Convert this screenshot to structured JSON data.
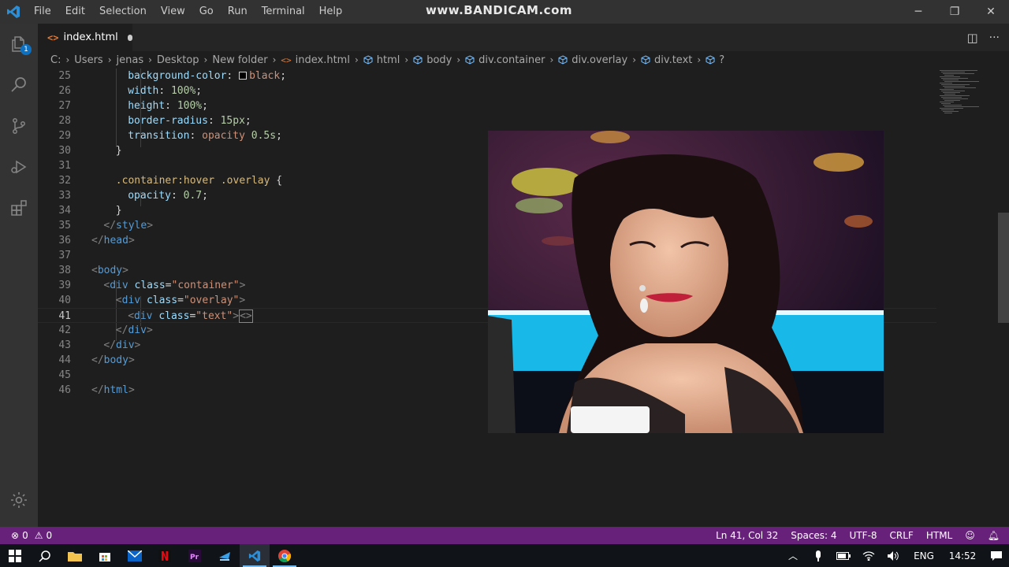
{
  "titlebar": {
    "menu": [
      "File",
      "Edit",
      "Selection",
      "View",
      "Go",
      "Run",
      "Terminal",
      "Help"
    ],
    "watermark": "www.BANDICAM.com",
    "controls": {
      "minimize": "─",
      "restore": "❐",
      "close": "✕"
    }
  },
  "activitybar": {
    "items": [
      "explorer-icon",
      "search-icon",
      "source-control-icon",
      "run-debug-icon",
      "extensions-icon"
    ],
    "explorer_badge": "1",
    "bottom": "gear-icon"
  },
  "tab": {
    "icon": "<>",
    "label": "index.html",
    "actions": {
      "split": "◫",
      "more": "···"
    }
  },
  "breadcrumb": {
    "path": [
      "C:",
      "Users",
      "jenas",
      "Desktop",
      "New folder"
    ],
    "file": "index.html",
    "symbols": [
      "html",
      "body",
      "div.container",
      "div.overlay",
      "div.text",
      "?"
    ]
  },
  "editor": {
    "current_line": 41,
    "lines": [
      {
        "n": "25",
        "indent": 6,
        "tokens": [
          [
            "prop",
            "background-color"
          ],
          [
            "punc",
            ": "
          ],
          [
            "swatch",
            ""
          ],
          [
            "val",
            "black"
          ],
          [
            "punc",
            ";"
          ]
        ]
      },
      {
        "n": "26",
        "indent": 6,
        "tokens": [
          [
            "prop",
            "width"
          ],
          [
            "punc",
            ": "
          ],
          [
            "num",
            "100%"
          ],
          [
            "punc",
            ";"
          ]
        ]
      },
      {
        "n": "27",
        "indent": 6,
        "tokens": [
          [
            "prop",
            "height"
          ],
          [
            "punc",
            ": "
          ],
          [
            "num",
            "100%"
          ],
          [
            "punc",
            ";"
          ]
        ]
      },
      {
        "n": "28",
        "indent": 6,
        "tokens": [
          [
            "prop",
            "border-radius"
          ],
          [
            "punc",
            ": "
          ],
          [
            "num",
            "15px"
          ],
          [
            "punc",
            ";"
          ]
        ]
      },
      {
        "n": "29",
        "indent": 6,
        "tokens": [
          [
            "prop",
            "transition"
          ],
          [
            "punc",
            ": "
          ],
          [
            "val",
            "opacity "
          ],
          [
            "num",
            "0.5s"
          ],
          [
            "punc",
            ";"
          ]
        ]
      },
      {
        "n": "30",
        "indent": 4,
        "tokens": [
          [
            "punc",
            "}"
          ]
        ]
      },
      {
        "n": "31",
        "indent": 0,
        "tokens": []
      },
      {
        "n": "32",
        "indent": 4,
        "tokens": [
          [
            "sel",
            ".container:hover .overlay"
          ],
          [
            "punc",
            " {"
          ]
        ]
      },
      {
        "n": "33",
        "indent": 6,
        "tokens": [
          [
            "prop",
            "opacity"
          ],
          [
            "punc",
            ": "
          ],
          [
            "num",
            "0.7"
          ],
          [
            "punc",
            ";"
          ]
        ]
      },
      {
        "n": "34",
        "indent": 4,
        "tokens": [
          [
            "punc",
            "}"
          ]
        ]
      },
      {
        "n": "35",
        "indent": 2,
        "tokens": [
          [
            "brk",
            "</"
          ],
          [
            "tag",
            "style"
          ],
          [
            "brk",
            ">"
          ]
        ]
      },
      {
        "n": "36",
        "indent": 0,
        "tokens": [
          [
            "brk",
            "</"
          ],
          [
            "tag",
            "head"
          ],
          [
            "brk",
            ">"
          ]
        ]
      },
      {
        "n": "37",
        "indent": 0,
        "tokens": []
      },
      {
        "n": "38",
        "indent": 0,
        "tokens": [
          [
            "brk",
            "<"
          ],
          [
            "tag",
            "body"
          ],
          [
            "brk",
            ">"
          ]
        ]
      },
      {
        "n": "39",
        "indent": 2,
        "tokens": [
          [
            "brk",
            "<"
          ],
          [
            "tag",
            "div "
          ],
          [
            "attr",
            "class"
          ],
          [
            "punc",
            "="
          ],
          [
            "str",
            "\"container\""
          ],
          [
            "brk",
            ">"
          ]
        ]
      },
      {
        "n": "40",
        "indent": 4,
        "tokens": [
          [
            "brk",
            "<"
          ],
          [
            "tag",
            "div "
          ],
          [
            "attr",
            "class"
          ],
          [
            "punc",
            "="
          ],
          [
            "str",
            "\"overlay\""
          ],
          [
            "brk",
            ">"
          ]
        ]
      },
      {
        "n": "41",
        "indent": 6,
        "tokens": [
          [
            "brk",
            "<"
          ],
          [
            "tag",
            "div "
          ],
          [
            "attr",
            "class"
          ],
          [
            "punc",
            "="
          ],
          [
            "str",
            "\"text\""
          ],
          [
            "brk",
            ">"
          ],
          [
            "cursor",
            "<>"
          ]
        ]
      },
      {
        "n": "42",
        "indent": 4,
        "tokens": [
          [
            "brk",
            "</"
          ],
          [
            "tag",
            "div"
          ],
          [
            "brk",
            ">"
          ]
        ]
      },
      {
        "n": "43",
        "indent": 2,
        "tokens": [
          [
            "brk",
            "</"
          ],
          [
            "tag",
            "div"
          ],
          [
            "brk",
            ">"
          ]
        ]
      },
      {
        "n": "44",
        "indent": 0,
        "tokens": [
          [
            "brk",
            "</"
          ],
          [
            "tag",
            "body"
          ],
          [
            "brk",
            ">"
          ]
        ]
      },
      {
        "n": "45",
        "indent": 0,
        "tokens": []
      },
      {
        "n": "46",
        "indent": 0,
        "tokens": [
          [
            "brk",
            "</"
          ],
          [
            "tag",
            "html"
          ],
          [
            "brk",
            ">"
          ]
        ]
      }
    ]
  },
  "statusbar": {
    "errors": "0",
    "warnings": "0",
    "position": "Ln 41, Col 32",
    "spaces": "Spaces: 4",
    "encoding": "UTF-8",
    "eol": "CRLF",
    "language": "HTML"
  },
  "taskbar": {
    "apps": [
      "windows-start-icon",
      "search-icon",
      "file-explorer-icon",
      "store-icon",
      "mail-icon",
      "netflix-icon",
      "premiere-icon",
      "app-icon",
      "vscode-icon",
      "chrome-icon"
    ],
    "language": "ENG",
    "time": "14:52"
  },
  "colors": {
    "statusbar": "#68217a",
    "accent": "#0e70c0"
  }
}
